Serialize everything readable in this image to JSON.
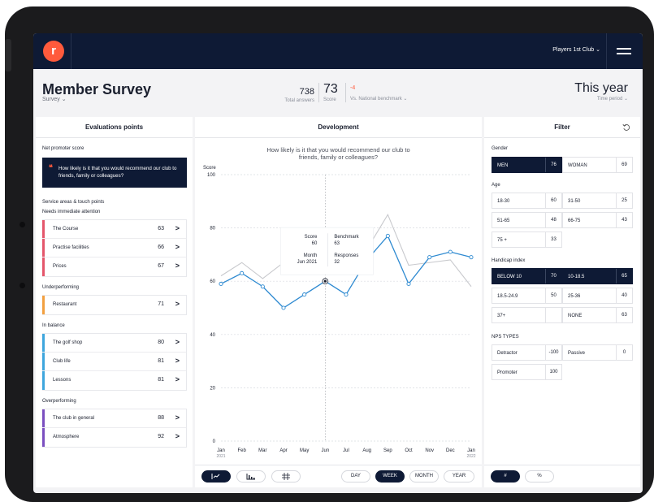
{
  "topbar": {
    "logo_letter": "r",
    "club_select": "Players 1st Club ⌄"
  },
  "header": {
    "title": "Member Survey",
    "survey_select": "Survey ⌄",
    "total_answers": "738",
    "total_answers_label": "Total answers",
    "score": "73",
    "score_label": "Score",
    "benchmark_delta": "-4",
    "benchmark_label": "Vs. National benchmark ⌄",
    "period": "This year",
    "period_label": "Time period ⌄"
  },
  "left": {
    "title": "Evaluations points",
    "nps_label": "Net promoter score",
    "nps_question": "How likely is it that you would recommend our club to friends, family or colleagues?",
    "service_label": "Service areas & touch points",
    "groups": [
      {
        "label": "Needs immediate attention",
        "color": "#e4566b",
        "items": [
          {
            "name": "The Course",
            "value": "63"
          },
          {
            "name": "Practise facilities",
            "value": "66"
          },
          {
            "name": "Prices",
            "value": "67"
          }
        ]
      },
      {
        "label": "Underperforming",
        "color": "#f2a040",
        "items": [
          {
            "name": "Restaurant",
            "value": "71"
          }
        ]
      },
      {
        "label": "In balance",
        "color": "#3ea6dd",
        "items": [
          {
            "name": "The golf shop",
            "value": "80"
          },
          {
            "name": "Club life",
            "value": "81"
          },
          {
            "name": "Lessons",
            "value": "81"
          }
        ]
      },
      {
        "label": "Overperforming",
        "color": "#7b4fc0",
        "items": [
          {
            "name": "The club in general",
            "value": "88"
          },
          {
            "name": "Atmosphere",
            "value": "92"
          }
        ]
      }
    ]
  },
  "middle": {
    "title": "Development",
    "question": "How likely is it that you would recommend our club to friends, family or colleagues?",
    "tooltip": {
      "score_label": "Score",
      "score": "60",
      "benchmark_label": "Benchmark",
      "benchmark": "63",
      "month_label": "Month",
      "month": "Jun 2021",
      "responses_label": "Responses",
      "responses": "32"
    },
    "chart_types": [
      "line-chart-icon",
      "bar-chart-icon",
      "scatter-icon"
    ],
    "granularity": [
      "DAY",
      "WEEK",
      "MONTH",
      "YEAR"
    ],
    "granularity_selected": "WEEK"
  },
  "chart_data": {
    "type": "line",
    "ylabel": "Score",
    "ylim": [
      0,
      100
    ],
    "yticks": [
      0,
      20,
      40,
      60,
      80,
      100
    ],
    "categories": [
      "Jan",
      "Feb",
      "Mar",
      "Apr",
      "May",
      "Jun",
      "Jul",
      "Aug",
      "Sep",
      "Oct",
      "Nov",
      "Dec",
      "Jan"
    ],
    "category_years": [
      "2021",
      "",
      "",
      "",
      "",
      "",
      "",
      "",
      "",
      "",
      "",
      "",
      "2022"
    ],
    "series": [
      {
        "color": "#2e8ad1",
        "values": [
          59,
          63,
          58,
          50,
          55,
          60,
          55,
          68,
          77,
          59,
          69,
          71,
          69
        ]
      },
      {
        "color": "#c8c9cd",
        "values": [
          62,
          67,
          61,
          67,
          65,
          63,
          67,
          72,
          85,
          66,
          67,
          68,
          58
        ]
      }
    ],
    "grid": true,
    "highlight_index": 5
  },
  "right": {
    "title": "Filter",
    "gender_label": "Gender",
    "gender": [
      {
        "name": "MEN",
        "value": "76",
        "selected": true
      },
      {
        "name": "WOMAN",
        "value": "69",
        "selected": false
      }
    ],
    "age_label": "Age",
    "age": [
      {
        "name": "18-30",
        "value": "60"
      },
      {
        "name": "31-50",
        "value": "25"
      },
      {
        "name": "51-65",
        "value": "48"
      },
      {
        "name": "66-75",
        "value": "43"
      },
      {
        "name": "75 +",
        "value": "33"
      }
    ],
    "handicap_label": "Handicap index",
    "handicap": [
      {
        "name": "BELOW 10",
        "value": "70",
        "selected": true
      },
      {
        "name": "10-18.5",
        "value": "65",
        "selected": true
      },
      {
        "name": "18.5-24.9",
        "value": "50"
      },
      {
        "name": "25-36",
        "value": "40"
      },
      {
        "name": "37+",
        "value": ""
      },
      {
        "name": "NONE",
        "value": "63"
      }
    ],
    "nps_label": "NPS TYPES",
    "nps": [
      {
        "name": "Detractor",
        "value": "-100"
      },
      {
        "name": "Passive",
        "value": "0"
      },
      {
        "name": "Promoter",
        "value": "100"
      }
    ],
    "unit_toggle": [
      "#",
      "%"
    ]
  }
}
